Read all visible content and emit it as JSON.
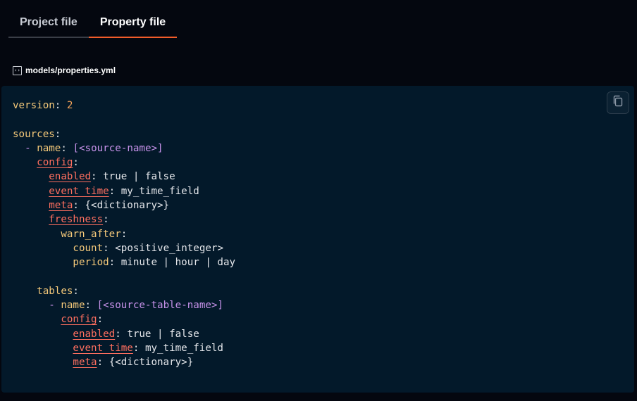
{
  "tabs": [
    {
      "label": "Project file",
      "active": false
    },
    {
      "label": "Property file",
      "active": true
    }
  ],
  "file": {
    "path": "models/properties.yml",
    "icon": "code-file-icon"
  },
  "copy": {
    "icon": "copy-icon"
  },
  "code": {
    "version_key": "version",
    "version_value": "2",
    "sources_key": "sources",
    "dash": "-",
    "name_key": "name",
    "source_name_value": "[<source-name>]",
    "config_key": "config",
    "enabled_key": "enabled",
    "enabled_value": "true | false",
    "event_time_key": "event_time",
    "event_time_value": "my_time_field",
    "meta_key": "meta",
    "meta_value": "{<dictionary>}",
    "freshness_key": "freshness",
    "warn_after_key": "warn_after",
    "count_key": "count",
    "count_value": "<positive_integer>",
    "period_key": "period",
    "period_value": "minute | hour | day",
    "tables_key": "tables",
    "table_name_value": "[<source-table-name>]"
  },
  "colors": {
    "accent": "#f25c2a",
    "key": "#f5c97a",
    "number": "#f6a45a",
    "punctuation": "#c792ea",
    "linked_key": "#ff6f5f",
    "panel_bg": "#03192a"
  }
}
